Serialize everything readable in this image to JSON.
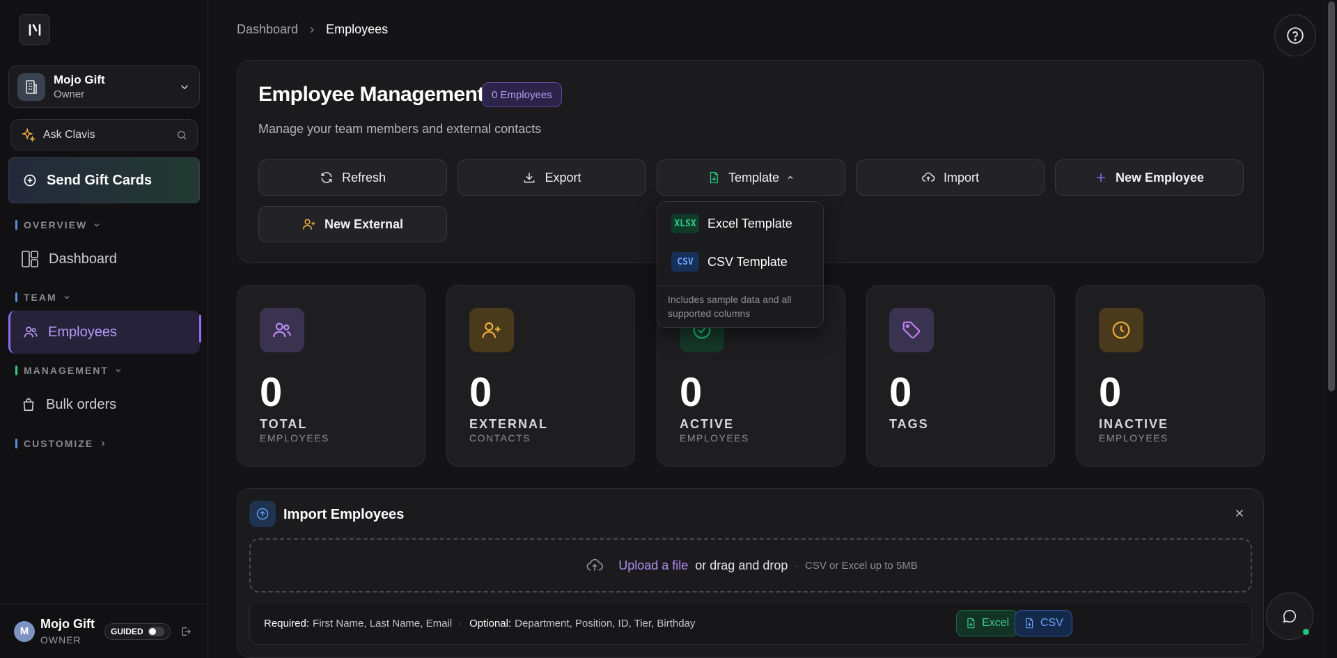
{
  "sidebar": {
    "org": {
      "name": "Mojo Gift",
      "role": "Owner"
    },
    "ask_label": "Ask Clavis",
    "send_label": "Send Gift Cards",
    "sections": {
      "overview": "OVERVIEW",
      "team": "TEAM",
      "management": "MANAGEMENT",
      "customize": "CUSTOMIZE"
    },
    "nav": {
      "dashboard": "Dashboard",
      "employees": "Employees",
      "bulk_orders": "Bulk orders"
    },
    "user": {
      "initial": "M",
      "name": "Mojo Gift",
      "role": "OWNER",
      "guided_label": "GUIDED"
    }
  },
  "breadcrumb": {
    "root": "Dashboard",
    "current": "Employees"
  },
  "header": {
    "title": "Employee Management",
    "badge": "0 Employees",
    "subtitle": "Manage your team members and external contacts"
  },
  "actions": {
    "refresh": "Refresh",
    "export": "Export",
    "template": "Template",
    "import": "Import",
    "new_employee": "New Employee",
    "new_external": "New External"
  },
  "template_menu": {
    "items": [
      {
        "tag": "XLSX",
        "label": "Excel Template"
      },
      {
        "tag": "CSV",
        "label": "CSV Template"
      }
    ],
    "note": "Includes sample data and all supported columns"
  },
  "stats": [
    {
      "value": "0",
      "label": "TOTAL",
      "sub": "EMPLOYEES",
      "icon": "users-icon",
      "color": "#b47bf4"
    },
    {
      "value": "0",
      "label": "EXTERNAL",
      "sub": "CONTACTS",
      "icon": "user-plus-icon",
      "color": "#f2b23a"
    },
    {
      "value": "0",
      "label": "ACTIVE",
      "sub": "EMPLOYEES",
      "icon": "check-circle-icon",
      "color": "#20c77c"
    },
    {
      "value": "0",
      "label": "TAGS",
      "sub": "",
      "icon": "tag-icon",
      "color": "#c280f4"
    },
    {
      "value": "0",
      "label": "INACTIVE",
      "sub": "EMPLOYEES",
      "icon": "clock-icon",
      "color": "#f2b23a"
    }
  ],
  "import_panel": {
    "title": "Import Employees",
    "upload_link": "Upload a file",
    "drag_text": "or drag and drop",
    "dot": "·",
    "hint": "CSV or Excel up to 5MB",
    "required_label": "Required:",
    "required_fields": "First Name, Last Name, Email",
    "optional_label": "Optional:",
    "optional_fields": "Department, Position, ID, Tier, Birthday",
    "excel_label": "Excel",
    "csv_label": "CSV"
  }
}
